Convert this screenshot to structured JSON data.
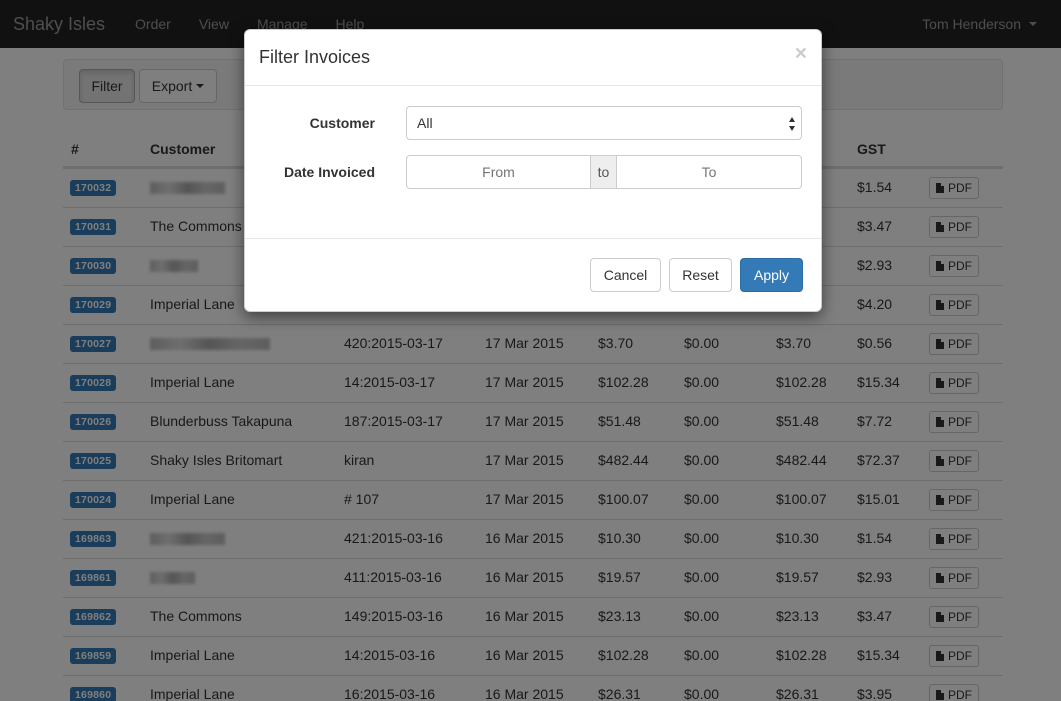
{
  "navbar": {
    "brand": "Shaky Isles",
    "items": [
      "Order",
      "View",
      "Manage",
      "Help"
    ],
    "user": "Tom Henderson"
  },
  "toolbar": {
    "filter_label": "Filter",
    "export_label": "Export"
  },
  "table": {
    "headers": [
      "#",
      "Customer",
      "",
      "",
      "",
      "",
      "",
      "GST",
      ""
    ],
    "rows": [
      {
        "id": "170032",
        "customer": "",
        "ref": "",
        "date": "",
        "sub": "",
        "disc": "",
        "total": "",
        "gst": "$1.54",
        "pdf": "PDF"
      },
      {
        "id": "170031",
        "customer": "The Commons",
        "ref": "",
        "date": "",
        "sub": "",
        "disc": "",
        "total": "",
        "gst": "$3.47",
        "pdf": "PDF"
      },
      {
        "id": "170030",
        "customer": "",
        "ref": "",
        "date": "",
        "sub": "",
        "disc": "",
        "total": "",
        "gst": "$2.93",
        "pdf": "PDF"
      },
      {
        "id": "170029",
        "customer": "Imperial Lane",
        "ref": "",
        "date": "",
        "sub": "",
        "disc": "",
        "total": "",
        "gst": "$4.20",
        "pdf": "PDF"
      },
      {
        "id": "170027",
        "customer": "",
        "ref": "420:2015-03-17",
        "date": "17 Mar 2015",
        "sub": "$3.70",
        "disc": "$0.00",
        "total": "$3.70",
        "gst": "$0.56",
        "pdf": "PDF"
      },
      {
        "id": "170028",
        "customer": "Imperial Lane",
        "ref": "14:2015-03-17",
        "date": "17 Mar 2015",
        "sub": "$102.28",
        "disc": "$0.00",
        "total": "$102.28",
        "gst": "$15.34",
        "pdf": "PDF"
      },
      {
        "id": "170026",
        "customer": "Blunderbuss Takapuna",
        "ref": "187:2015-03-17",
        "date": "17 Mar 2015",
        "sub": "$51.48",
        "disc": "$0.00",
        "total": "$51.48",
        "gst": "$7.72",
        "pdf": "PDF"
      },
      {
        "id": "170025",
        "customer": "Shaky Isles Britomart",
        "ref": "kiran",
        "date": "17 Mar 2015",
        "sub": "$482.44",
        "disc": "$0.00",
        "total": "$482.44",
        "gst": "$72.37",
        "pdf": "PDF"
      },
      {
        "id": "170024",
        "customer": "Imperial Lane",
        "ref": "# 107",
        "date": "17 Mar 2015",
        "sub": "$100.07",
        "disc": "$0.00",
        "total": "$100.07",
        "gst": "$15.01",
        "pdf": "PDF"
      },
      {
        "id": "169863",
        "customer": "",
        "ref": "421:2015-03-16",
        "date": "16 Mar 2015",
        "sub": "$10.30",
        "disc": "$0.00",
        "total": "$10.30",
        "gst": "$1.54",
        "pdf": "PDF"
      },
      {
        "id": "169861",
        "customer": "",
        "ref": "411:2015-03-16",
        "date": "16 Mar 2015",
        "sub": "$19.57",
        "disc": "$0.00",
        "total": "$19.57",
        "gst": "$2.93",
        "pdf": "PDF"
      },
      {
        "id": "169862",
        "customer": "The Commons",
        "ref": "149:2015-03-16",
        "date": "16 Mar 2015",
        "sub": "$23.13",
        "disc": "$0.00",
        "total": "$23.13",
        "gst": "$3.47",
        "pdf": "PDF"
      },
      {
        "id": "169859",
        "customer": "Imperial Lane",
        "ref": "14:2015-03-16",
        "date": "16 Mar 2015",
        "sub": "$102.28",
        "disc": "$0.00",
        "total": "$102.28",
        "gst": "$15.34",
        "pdf": "PDF"
      },
      {
        "id": "169860",
        "customer": "Imperial Lane",
        "ref": "16:2015-03-16",
        "date": "16 Mar 2015",
        "sub": "$26.31",
        "disc": "$0.00",
        "total": "$26.31",
        "gst": "$3.95",
        "pdf": "PDF"
      }
    ]
  },
  "modal": {
    "title": "Filter Invoices",
    "close": "×",
    "customer_label": "Customer",
    "customer_value": "All",
    "date_label": "Date Invoiced",
    "from_placeholder": "From",
    "to_word": "to",
    "to_placeholder": "To",
    "cancel_label": "Cancel",
    "reset_label": "Reset",
    "apply_label": "Apply"
  },
  "colors": {
    "navbar": "#222222",
    "primary": "#337ab7",
    "label": "#337ab7"
  }
}
